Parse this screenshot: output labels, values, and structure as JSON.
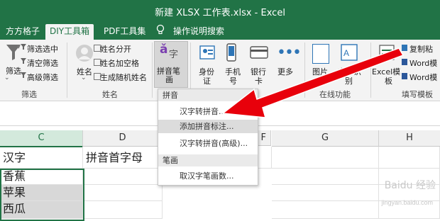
{
  "window": {
    "title": "新建 XLSX 工作表.xlsx  -  Excel"
  },
  "tabs": [
    {
      "label": "方方格子"
    },
    {
      "label": "DIY工具箱"
    },
    {
      "label": "PDF工具集"
    },
    {
      "label": "操作说明搜索"
    }
  ],
  "ribbon": {
    "filter_group": {
      "btn": "筛选",
      "items": [
        "筛选选中",
        "清空筛选",
        "高级筛选"
      ],
      "label": "筛选"
    },
    "name_group": {
      "btn": "姓名",
      "items": [
        "姓名分开",
        "姓名加空格",
        "生成随机姓名"
      ],
      "label": "姓名"
    },
    "pinyin_btn": {
      "line1": "拼音笔",
      "line2": "画"
    },
    "id_btn": {
      "line1": "身份",
      "line2": "证"
    },
    "phone_btn": {
      "line1": "手机",
      "line2": "号"
    },
    "bank_btn": {
      "line1": "银行",
      "line2": "卡"
    },
    "more_btn": "更多",
    "online_group": {
      "btn1": "图片",
      "btn2": "文字识",
      "btn2b": "别",
      "label": "在线功能"
    },
    "fill_group": {
      "btn": "Excel模",
      "btn_b": "板",
      "items": [
        "复制粘",
        "Word模",
        "Word模"
      ],
      "label": "填写模板"
    }
  },
  "columns": [
    {
      "label": "C",
      "selected": true
    },
    {
      "label": "D",
      "selected": false
    },
    {
      "label": "F",
      "selected": false
    },
    {
      "label": "G",
      "selected": false
    },
    {
      "label": "H",
      "selected": false
    }
  ],
  "cells": {
    "c1": "汉字",
    "d1": "拼音首字母",
    "c2": "香蕉",
    "c3": "苹果",
    "c4": "西瓜"
  },
  "dropdown": {
    "header1": "拼音",
    "items1": [
      "汉字转拼音...",
      "添加拼音标注...",
      "汉字转拼音(高级)..."
    ],
    "header2": "笔画",
    "items2": [
      "取汉字笔画数..."
    ]
  },
  "watermark": {
    "main": "Baidu 经验",
    "sub": "jingyan.baidu.com"
  },
  "colors": {
    "excel_green": "#217346",
    "arrow_red": "#e8000b"
  }
}
